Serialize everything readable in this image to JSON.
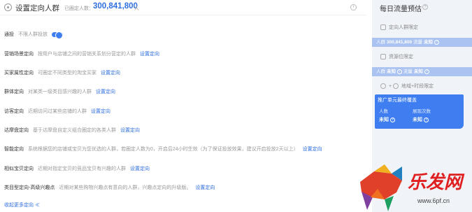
{
  "header": {
    "title": "设置定向人群",
    "count_label": "已圈定人数：",
    "count_value": "300,841,800",
    "count_unit": "人",
    "info_glyph": "i"
  },
  "rows": [
    {
      "label": "通投",
      "desc": "不限人群投放",
      "toggle": true
    },
    {
      "label": "营销场景定向",
      "desc": "按用户与店铺之间的营销关系划分营定的人群",
      "action": "设置定向"
    },
    {
      "label": "买家属性定向",
      "desc": "可圈定不同类型的淘宝买家",
      "action": "设置定向"
    },
    {
      "label": "群体定向",
      "desc": "对某类一级类目感兴趣的人群",
      "action": "设置定向"
    },
    {
      "label": "访客定向",
      "desc": "近期访问过某些店铺的人群",
      "action": "设置定向"
    },
    {
      "label": "达摩盘定向",
      "desc": "基于达摩盘自定义组合圈定的各类人群",
      "action": "设置定向"
    },
    {
      "label": "智能定向",
      "desc": "系统根据您的店铺或宝贝为您优选的人群，若圈定人数为0，开启后24小时生效（为了保证投放效果，建议开启投放2天以上）",
      "action": "设置定向"
    },
    {
      "label": "相似宝贝定向",
      "desc": "近期对指定宝贝的竞品宝贝有兴趣的人群",
      "action": "设置定向"
    },
    {
      "label": "类目型定向-高级兴趣点",
      "desc": "近期对某些购物兴趣点有意向的人群，兴趣点定向的升级版。",
      "action": "设置定向"
    }
  ],
  "collapse_label": "收起更多定向 ≪",
  "right": {
    "title": "每日流量预估",
    "q_glyph": "?",
    "step1": "定向人群限定",
    "band1_label": "人群",
    "band1_value": "300,841,800",
    "band1_sep": " 流量",
    "band1_value2": "未知",
    "step2": "资源位限定",
    "band2_label": "人群",
    "band2_value": "未知",
    "band2_sep": " 流量",
    "band2_value2": "未知",
    "step3": "地域+时段限定",
    "final_title": "推广单元最终覆盖",
    "final_l1": "人数",
    "final_l2": "展现次数",
    "final_v1": "未知",
    "final_v2": "未知"
  },
  "watermark": {
    "text": "乐发网",
    "url": "www.6pf.cn"
  }
}
